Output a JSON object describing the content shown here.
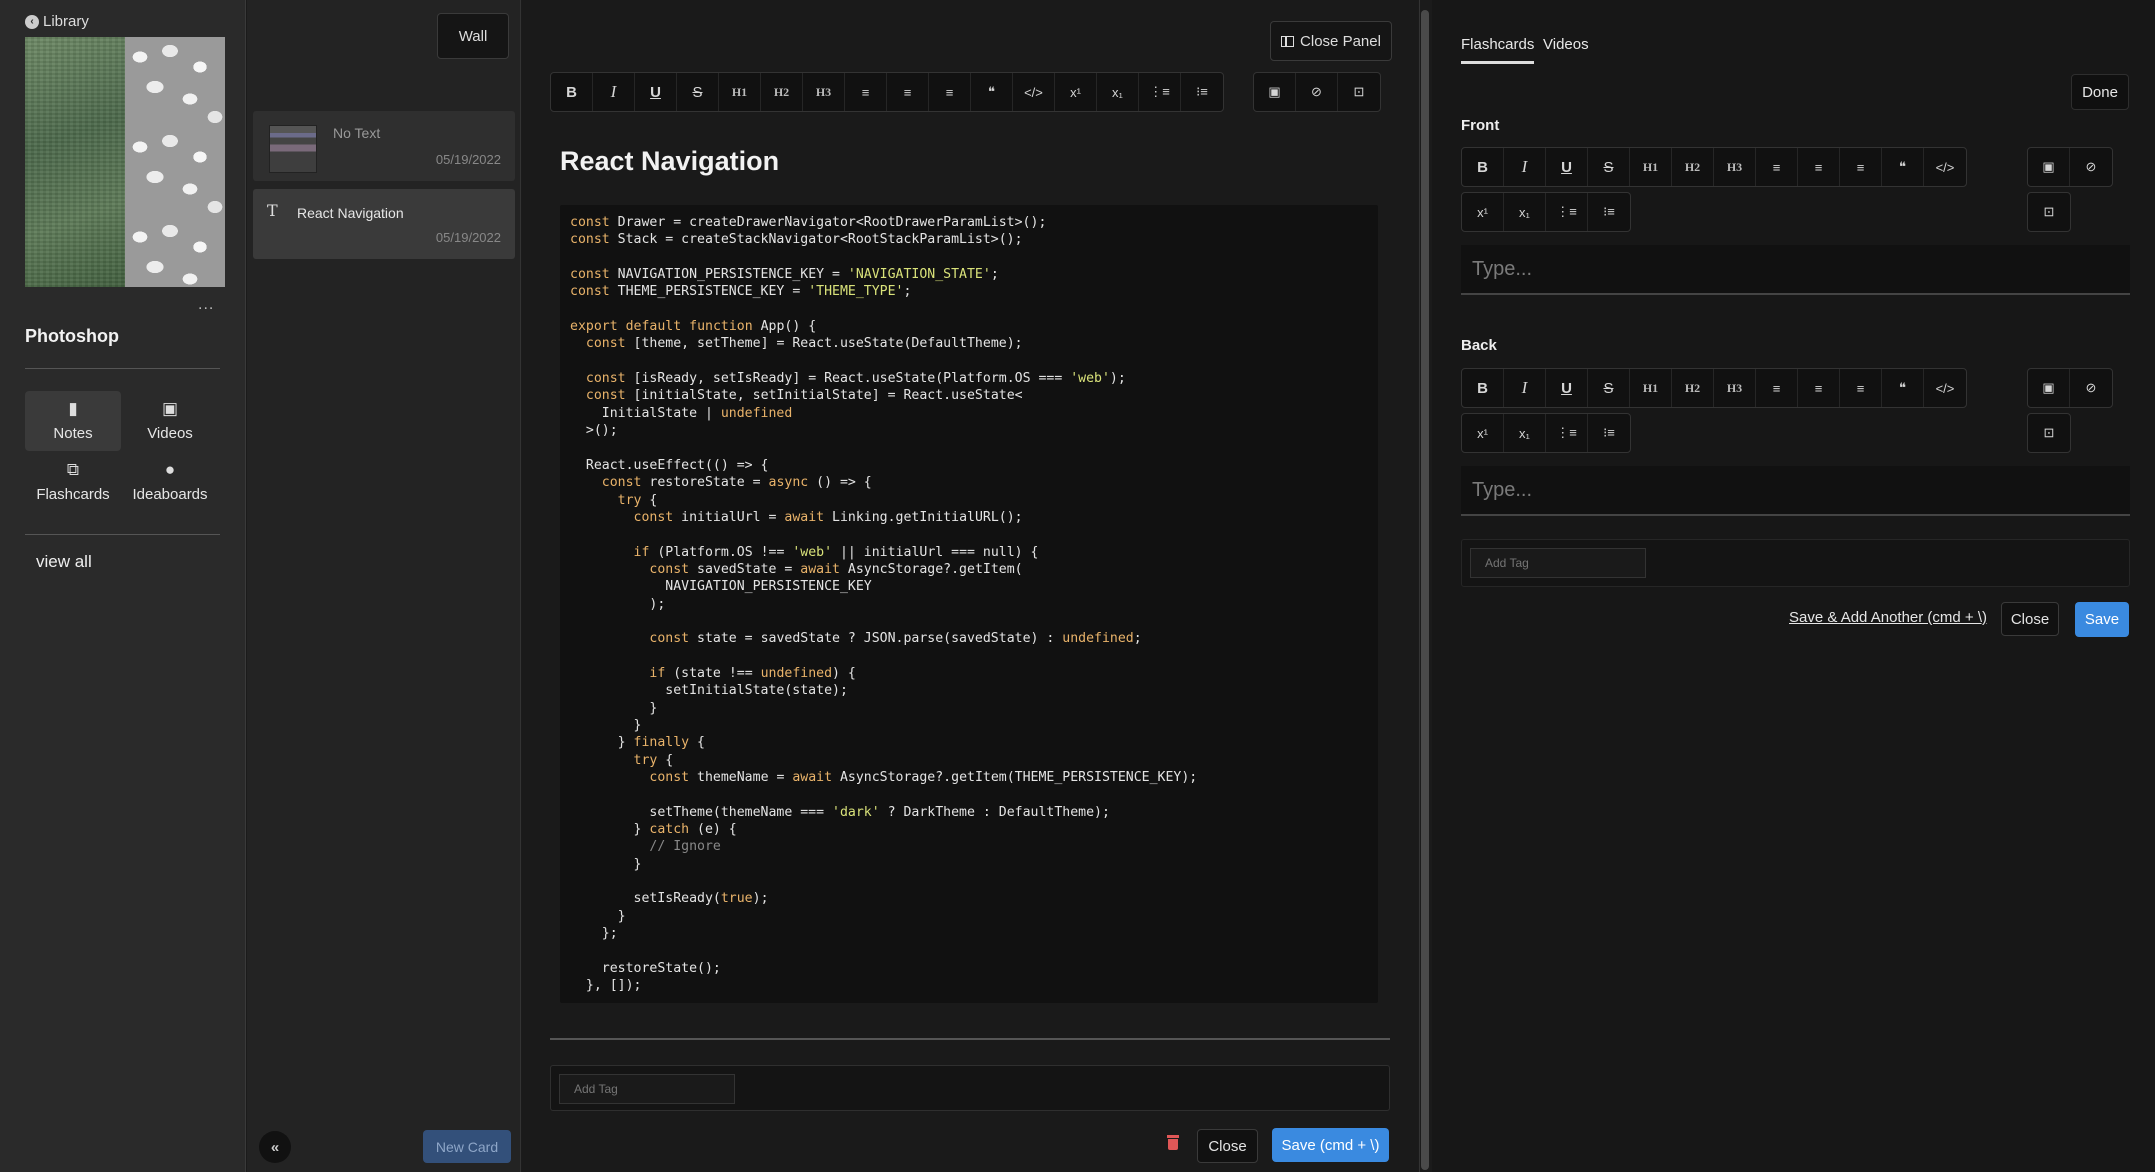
{
  "sidebar": {
    "back_label": "Library",
    "title": "Photoshop",
    "more": "...",
    "nav": [
      {
        "label": "Notes",
        "icon": "notebook-icon"
      },
      {
        "label": "Videos",
        "icon": "video-icon"
      },
      {
        "label": "Flashcards",
        "icon": "flashcards-icon"
      },
      {
        "label": "Ideaboards",
        "icon": "lightbulb-icon"
      }
    ],
    "view_all": "view all"
  },
  "notes_list": {
    "wall_label": "Wall",
    "items": [
      {
        "title": "No Text",
        "date": "05/19/2022"
      },
      {
        "title": "React Navigation",
        "date": "05/19/2022"
      }
    ],
    "new_card_label": "New Card"
  },
  "editor": {
    "close_panel_label": "Close Panel",
    "toolbar": [
      "B",
      "I",
      "U",
      "S",
      "H1",
      "H2",
      "H3",
      "≡",
      "≡",
      "≡",
      "❝",
      "</>",
      "x¹",
      "x₁",
      "⋮≡",
      "⁝≡"
    ],
    "media_toolbar": [
      "▣",
      "⊘",
      "⊡"
    ],
    "title": "React Navigation",
    "code_lines": [
      "const Drawer = createDrawerNavigator<RootDrawerParamList>();",
      "const Stack = createStackNavigator<RootStackParamList>();",
      "",
      "const NAVIGATION_PERSISTENCE_KEY = 'NAVIGATION_STATE';",
      "const THEME_PERSISTENCE_KEY = 'THEME_TYPE';",
      "",
      "export default function App() {",
      "  const [theme, setTheme] = React.useState(DefaultTheme);",
      "",
      "  const [isReady, setIsReady] = React.useState(Platform.OS === 'web');",
      "  const [initialState, setInitialState] = React.useState<",
      "    InitialState | undefined",
      "  >();",
      "",
      "  React.useEffect(() => {",
      "    const restoreState = async () => {",
      "      try {",
      "        const initialUrl = await Linking.getInitialURL();",
      "",
      "        if (Platform.OS !== 'web' || initialUrl === null) {",
      "          const savedState = await AsyncStorage?.getItem(",
      "            NAVIGATION_PERSISTENCE_KEY",
      "          );",
      "",
      "          const state = savedState ? JSON.parse(savedState) : undefined;",
      "",
      "          if (state !== undefined) {",
      "            setInitialState(state);",
      "          }",
      "        }",
      "      } finally {",
      "        try {",
      "          const themeName = await AsyncStorage?.getItem(THEME_PERSISTENCE_KEY);",
      "",
      "          setTheme(themeName === 'dark' ? DarkTheme : DefaultTheme);",
      "        } catch (e) {",
      "          // Ignore",
      "        }",
      "",
      "        setIsReady(true);",
      "      }",
      "    };",
      "",
      "    restoreState();",
      "  }, []);"
    ],
    "tag_placeholder": "Add Tag",
    "close_label": "Close",
    "save_label": "Save (cmd + \\)"
  },
  "flashcard_panel": {
    "tabs": [
      "Flashcards",
      "Videos"
    ],
    "done_label": "Done",
    "front_label": "Front",
    "back_label": "Back",
    "type_placeholder": "Type...",
    "toolbar_row1": [
      "B",
      "I",
      "U",
      "S",
      "H1",
      "H2",
      "H3",
      "≡",
      "≡",
      "≡",
      "❝",
      "</>"
    ],
    "toolbar_row2": [
      "x¹",
      "x₁",
      "⋮≡",
      "⁝≡"
    ],
    "tag_placeholder": "Add Tag",
    "save_add_label": "Save & Add Another (cmd + \\)",
    "close_label": "Close",
    "save_label": "Save"
  },
  "colors": {
    "accent": "#3a8ae0",
    "keyword": "#e9b36a",
    "string": "#d9e27a",
    "delete": "#e05757"
  }
}
